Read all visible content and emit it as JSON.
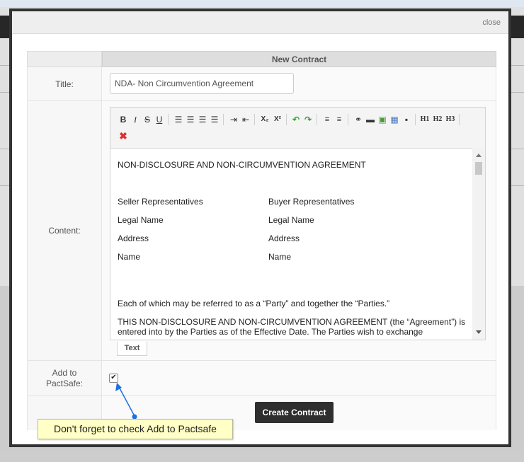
{
  "modal": {
    "close_label": "close",
    "header_title": "New Contract"
  },
  "form": {
    "title_label": "Title:",
    "title_value": "NDA- Non Circumvention Agreement",
    "content_label": "Content:",
    "pactsafe_label_line1": "Add to",
    "pactsafe_label_line2": "PactSafe:",
    "pactsafe_checked": true,
    "submit_label": "Create Contract"
  },
  "editor": {
    "toolbar_icons": [
      "bold-icon",
      "italic-icon",
      "strikethrough-icon",
      "underline-icon",
      "align-left-icon",
      "align-center-icon",
      "align-right-icon",
      "align-justify-icon",
      "indent-icon",
      "outdent-icon",
      "subscript-icon",
      "superscript-icon",
      "undo-icon",
      "redo-icon",
      "ordered-list-icon",
      "unordered-list-icon",
      "link-icon",
      "horizontal-rule-icon",
      "image-icon",
      "table-icon",
      "html-icon",
      "h1-icon",
      "h2-icon",
      "h3-icon",
      "remove-format-icon"
    ],
    "toolbar_labels": {
      "bold": "B",
      "italic": "I",
      "strike": "S",
      "underline": "U",
      "sub": "X₂",
      "sup": "X²",
      "h1": "H1",
      "h2": "H2",
      "h3": "H3"
    },
    "tab_label": "Text",
    "content": {
      "heading": "NON-DISCLOSURE AND NON-CIRCUMVENTION AGREEMENT",
      "seller_header": "Seller Representatives",
      "buyer_header": "Buyer Representatives",
      "legal_name_left": "Legal Name",
      "legal_name_right": "Legal Name",
      "address_left": "Address",
      "address_right": "Address",
      "name_left": "Name",
      "name_right": "Name",
      "para1": "Each of which may be referred to as a “Party” and together the “Parties.”",
      "para2_line1": "THIS NON-DISCLOSURE AND NON-CIRCUMVENTION AGREEMENT (the “Agreement”) is",
      "para2_line2": "entered into by the Parties as of the Effective Date. The Parties wish to exchange"
    }
  },
  "annotation": {
    "tooltip_text": "Don't forget to check Add to Pactsafe",
    "arrow_color": "#1f6fe0"
  }
}
